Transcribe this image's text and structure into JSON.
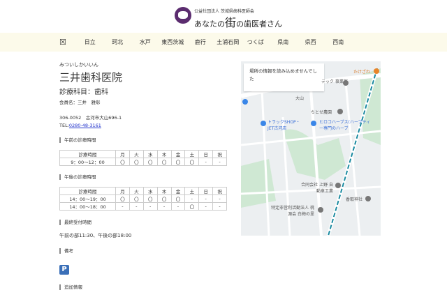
{
  "header": {
    "org": "公益社団法人 茨城県歯科医師会",
    "site_pre": "あなたの",
    "site_big": "街",
    "site_post": "の歯医者さん"
  },
  "nav": {
    "icon": "☒",
    "items": [
      "日立",
      "珂北",
      "水戸",
      "東西茨城",
      "鹿行",
      "土浦石岡",
      "つくば",
      "県南",
      "県西",
      "西南"
    ]
  },
  "clinic": {
    "kana": "みついしかいいん",
    "name": "三井歯科医院",
    "dept": "診療科目：歯科",
    "member": "会員名：三井　雅彰",
    "address": "306-0052　古河市大山696-1",
    "tel_label": "TEL:",
    "tel": "0280-48-3161"
  },
  "morning": {
    "title": "午前の診療時間",
    "header": [
      "診療時間",
      "月",
      "火",
      "水",
      "木",
      "金",
      "土",
      "日",
      "祝"
    ],
    "rows": [
      [
        "9：00～12：00",
        "〇",
        "〇",
        "〇",
        "〇",
        "〇",
        "〇",
        "-",
        "-"
      ]
    ]
  },
  "afternoon": {
    "title": "午後の診療時間",
    "header": [
      "診療時間",
      "月",
      "火",
      "水",
      "木",
      "金",
      "土",
      "日",
      "祝"
    ],
    "rows": [
      [
        "14：00～19：00",
        "〇",
        "〇",
        "〇",
        "〇",
        "〇",
        "-",
        "-",
        "-"
      ],
      [
        "14：00～18：00",
        "-",
        "-",
        "-",
        "-",
        "-",
        "〇",
        "-",
        "-"
      ]
    ]
  },
  "last": {
    "title": "最終受付時間",
    "text": "午前の部11:30、午後の部18:00"
  },
  "notes": {
    "title": "備考",
    "parking": "P"
  },
  "extra": {
    "title": "追加情報"
  },
  "map": {
    "error": "場所の情報を読み込めませんでした",
    "labels": [
      "たけざわ",
      "テック 事業部",
      "大山",
      "ちとせ農園",
      "トラックSHOP・JET古河店",
      "ヒロコハーブス(ハーブティー専門のハーブ",
      "合同会社 上野 自動車工業",
      "香取神社",
      "特定非営利活動法人 桃源会 白梅の里"
    ]
  }
}
